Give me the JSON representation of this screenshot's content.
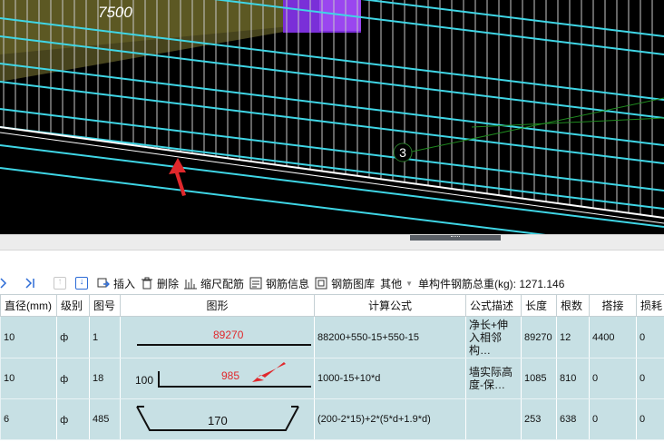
{
  "viewport": {
    "dimension_label": "7500",
    "axis_marker": "3"
  },
  "toolbar": {
    "insert_label": "插入",
    "delete_label": "删除",
    "scale_label": "缩尺配筋",
    "info_label": "钢筋信息",
    "library_label": "钢筋图库",
    "other_label": "其他",
    "total_label": "单构件钢筋总重(kg): 1271.146"
  },
  "grid": {
    "headers": [
      "直径(mm)",
      "级别",
      "图号",
      "图形",
      "计算公式",
      "公式描述",
      "长度",
      "根数",
      "搭接",
      "损耗"
    ],
    "rows": [
      {
        "diameter": "10",
        "grade": "ф",
        "figure_no": "1",
        "shape_value": "89270",
        "shape_left": "",
        "formula": "88200+550-15+550-15",
        "desc": "净长+伸入相邻构…",
        "length": "89270",
        "count": "12",
        "lap": "4400",
        "loss": "0"
      },
      {
        "diameter": "10",
        "grade": "ф",
        "figure_no": "18",
        "shape_value": "985",
        "shape_left": "100",
        "formula": "1000-15+10*d",
        "desc": "墙实际高度-保…",
        "length": "1085",
        "count": "810",
        "lap": "0",
        "loss": "0"
      },
      {
        "diameter": "6",
        "grade": "ф",
        "figure_no": "485",
        "shape_value": "170",
        "shape_left": "",
        "formula": "(200-2*15)+2*(5*d+1.9*d)",
        "desc": "",
        "length": "253",
        "count": "638",
        "lap": "0",
        "loss": "0"
      }
    ]
  },
  "colors": {
    "rebar_cyan": "#3fd6e6",
    "viewport_bg": "#000000",
    "grid_row_bg": "#c7e0e4",
    "annotation_red": "#e0282c"
  }
}
